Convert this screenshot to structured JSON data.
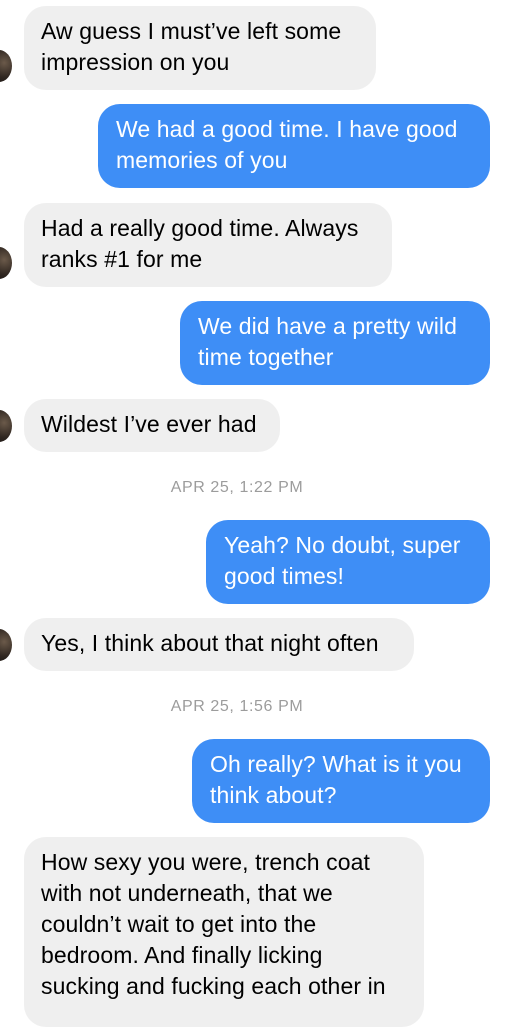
{
  "colors": {
    "incoming_bubble": "#efefef",
    "outgoing_bubble": "#3e8ef6",
    "timestamp_text": "#9c9c9c"
  },
  "messages": [
    {
      "direction": "incoming",
      "text": "Aw guess I must’ve left some\nimpression on you"
    },
    {
      "direction": "outgoing",
      "text": "We had a good time. I have good\nmemories of you"
    },
    {
      "direction": "incoming",
      "text": "Had a really good time. Always\nranks #1 for me"
    },
    {
      "direction": "outgoing",
      "text": "We did have a pretty wild\ntime together"
    },
    {
      "direction": "incoming",
      "text": "Wildest I’ve ever had"
    },
    {
      "direction": "timestamp",
      "text": "APR 25, 1:22 PM"
    },
    {
      "direction": "outgoing",
      "text": "Yeah? No doubt, super\ngood times!"
    },
    {
      "direction": "incoming",
      "text": "Yes, I think about that night often"
    },
    {
      "direction": "timestamp",
      "text": "APR 25, 1:56 PM"
    },
    {
      "direction": "outgoing",
      "text": "Oh really? What is it you\nthink about?"
    },
    {
      "direction": "incoming",
      "text": "How sexy you were, trench coat\nwith not underneath, that we\ncouldn’t wait to get into the\nbedroom. And finally licking\nsucking and fucking each other in"
    }
  ]
}
